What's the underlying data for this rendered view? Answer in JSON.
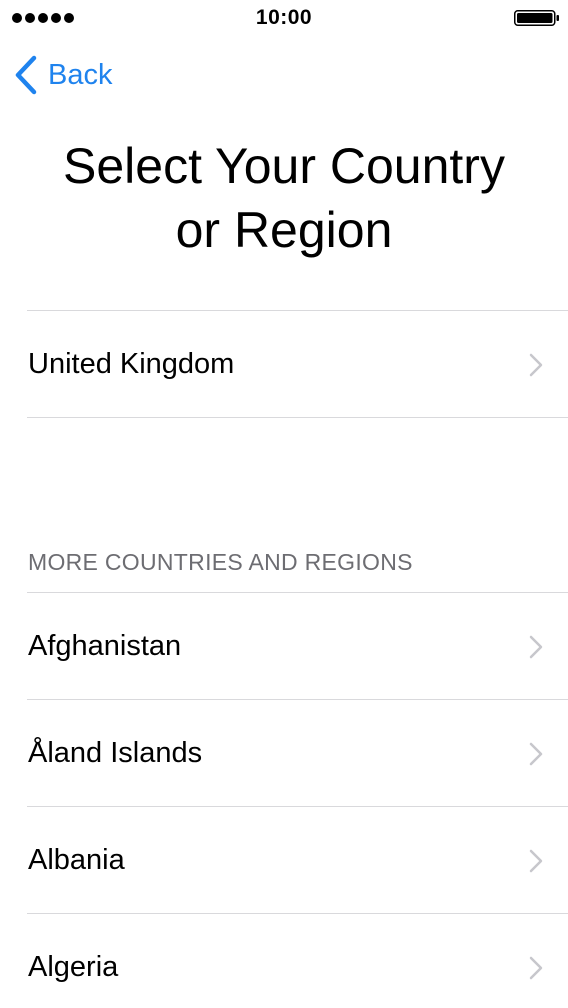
{
  "status_bar": {
    "time": "10:00",
    "signal_icon": "signal-dots-icon",
    "battery_icon": "battery-full-icon"
  },
  "nav": {
    "back_label": "Back",
    "back_icon": "chevron-left-icon",
    "accent_color": "#1f83ee"
  },
  "page": {
    "title_line1": "Select Your Country",
    "title_line2": "or Region"
  },
  "suggested": {
    "items": [
      {
        "label": "United Kingdom"
      }
    ]
  },
  "more": {
    "header": "MORE COUNTRIES AND REGIONS",
    "items": [
      {
        "label": "Afghanistan"
      },
      {
        "label": "Åland Islands"
      },
      {
        "label": "Albania"
      },
      {
        "label": "Algeria"
      }
    ]
  },
  "row_icon": "chevron-right-icon"
}
